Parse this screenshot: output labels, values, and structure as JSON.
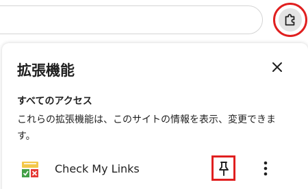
{
  "toolbar": {
    "extensions_button_icon": "puzzle-piece-icon",
    "highlight_color": "#e01f1f"
  },
  "panel": {
    "title": "拡張機能",
    "close_icon": "close-icon",
    "access_section": {
      "heading": "すべてのアクセス",
      "description": "これらの拡張機能は、このサイトの情報を表示、変更できます。"
    },
    "extensions": [
      {
        "name": "Check My Links",
        "icon": "check-my-links-icon",
        "pin_icon": "pin-icon",
        "menu_icon": "more-vert-icon"
      }
    ]
  }
}
